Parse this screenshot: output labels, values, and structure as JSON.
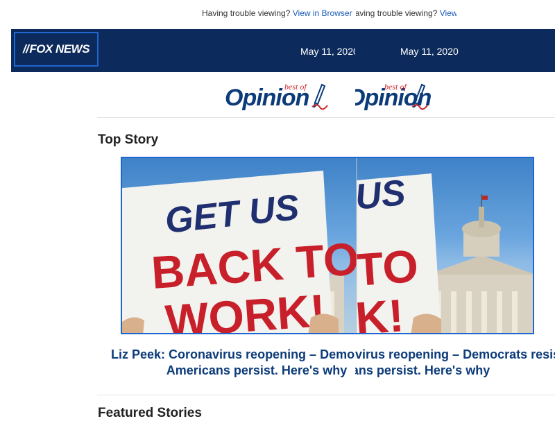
{
  "preheader": {
    "text": "Having trouble viewing?",
    "link": "View in Browser"
  },
  "header": {
    "logo": "FOX NEWS",
    "date": "May 11, 2020"
  },
  "brand": {
    "best_of": "best of",
    "opinion": "Opinion"
  },
  "top_story": {
    "section_title": "Top Story",
    "image_sign": {
      "line1": "GET US",
      "line2": "BACK TO",
      "line3": "WORK!"
    },
    "headline_line1": "Liz Peek: Coronavirus reopening – Democrats resist,",
    "headline_line2": "Americans persist. Here's why"
  },
  "featured": {
    "section_title": "Featured Stories"
  }
}
